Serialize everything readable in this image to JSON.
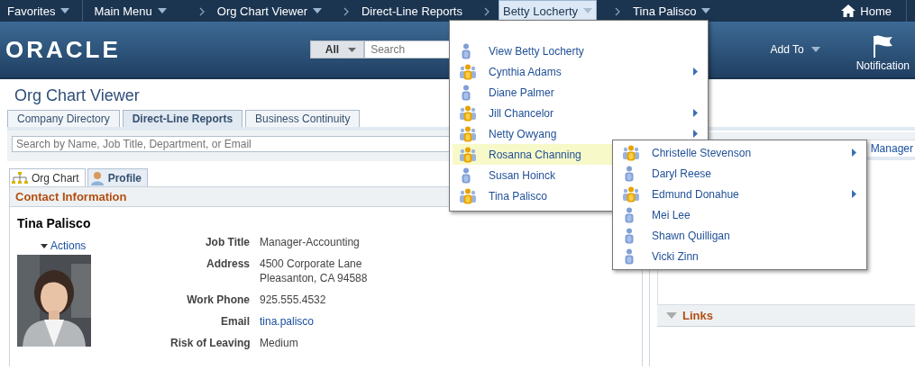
{
  "top_nav": {
    "items": [
      {
        "label": "Favorites",
        "dropdown": true
      },
      {
        "label": "Main Menu",
        "dropdown": true
      }
    ],
    "breadcrumbs": [
      {
        "label": "Org Chart Viewer",
        "dropdown": true,
        "selected": false
      },
      {
        "label": "Direct-Line Reports",
        "dropdown": false,
        "selected": false
      },
      {
        "label": "Betty Locherty",
        "dropdown": true,
        "selected": true
      },
      {
        "label": "Tina Palisco",
        "dropdown": true,
        "selected": false
      }
    ],
    "home": "Home"
  },
  "header": {
    "logo": "ORACLE",
    "search_scope": "All",
    "search_placeholder": "Search",
    "add_to": "Add To",
    "notification": "Notification"
  },
  "page_title": "Org Chart Viewer",
  "tabs": [
    {
      "label": "Company Directory",
      "selected": false
    },
    {
      "label": "Direct-Line Reports",
      "selected": true
    },
    {
      "label": "Business Continuity",
      "selected": false
    }
  ],
  "search_field": {
    "placeholder": "Search by Name, Job Title, Department, or Email"
  },
  "view_tabs": [
    {
      "label": "Org Chart",
      "kind": "chart",
      "selected": false
    },
    {
      "label": "Profile",
      "kind": "profile",
      "selected": true
    }
  ],
  "contact": {
    "title": "Contact Information",
    "name": "Tina Palisco",
    "actions": "Actions",
    "fields": [
      {
        "label": "Job Title",
        "kind": "text",
        "values": [
          "Manager-Accounting"
        ]
      },
      {
        "label": "Address",
        "kind": "text",
        "values": [
          "4500 Corporate Lane",
          "Pleasanton, CA 94588"
        ]
      },
      {
        "label": "Work Phone",
        "kind": "text",
        "values": [
          "925.555.4532"
        ]
      },
      {
        "label": "Email",
        "kind": "link",
        "values": [
          "tina.palisco"
        ]
      },
      {
        "label": "Risk of Leaving",
        "kind": "text",
        "values": [
          "Medium"
        ]
      }
    ]
  },
  "right_panel": {
    "fragment": "Manager",
    "links_title": "Links"
  },
  "menu": {
    "items": [
      {
        "label": "View Betty Locherty",
        "kind": "person",
        "submenu": false,
        "selected": false
      },
      {
        "label": "Cynthia Adams",
        "kind": "manager",
        "submenu": true,
        "selected": false
      },
      {
        "label": "Diane Palmer",
        "kind": "person",
        "submenu": false,
        "selected": false
      },
      {
        "label": "Jill Chancelor",
        "kind": "manager",
        "submenu": true,
        "selected": false
      },
      {
        "label": "Netty Owyang",
        "kind": "manager",
        "submenu": true,
        "selected": false
      },
      {
        "label": "Rosanna Channing",
        "kind": "manager",
        "submenu": true,
        "selected": true
      },
      {
        "label": "Susan Hoinck",
        "kind": "person",
        "selected": false
      },
      {
        "label": "Tina Palisco",
        "kind": "manager",
        "selected": false
      }
    ]
  },
  "submenu": {
    "items": [
      {
        "label": "Christelle Stevenson",
        "kind": "manager",
        "submenu": true,
        "selected": false
      },
      {
        "label": "Daryl Reese",
        "kind": "person",
        "submenu": false,
        "selected": false
      },
      {
        "label": "Edmund Donahue",
        "kind": "manager",
        "submenu": true,
        "selected": false
      },
      {
        "label": "Mei Lee",
        "kind": "person",
        "submenu": false,
        "selected": false
      },
      {
        "label": "Shawn Quilligan",
        "kind": "person",
        "submenu": false,
        "selected": false
      },
      {
        "label": "Vicki Zinn",
        "kind": "person",
        "submenu": false,
        "selected": false
      }
    ]
  }
}
